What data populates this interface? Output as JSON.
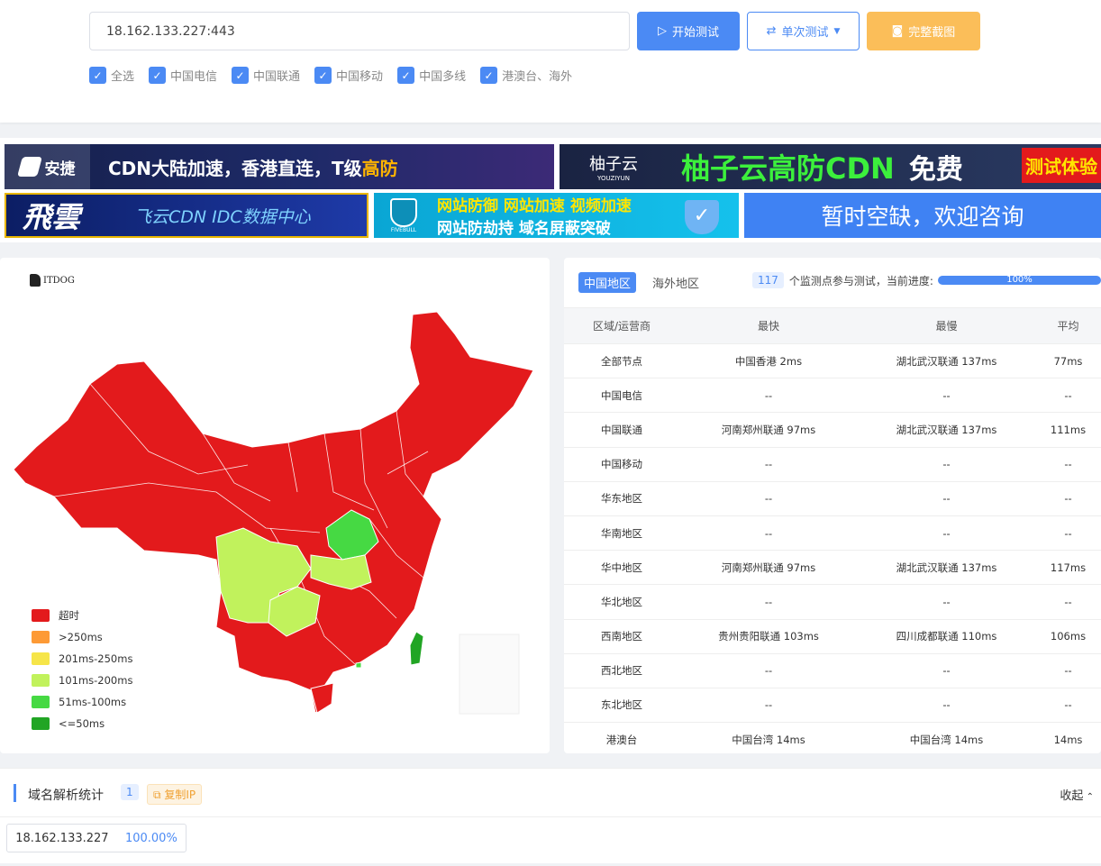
{
  "search": {
    "value": "18.162.133.227:443"
  },
  "buttons": {
    "start": "开始测试",
    "single": "单次测试",
    "screenshot": "完整截图"
  },
  "checkboxes": [
    "全选",
    "中国电信",
    "中国联通",
    "中国移动",
    "中国多线",
    "港澳台、海外"
  ],
  "banners": {
    "b1_brand": "安捷",
    "b1_text": "CDN大陆加速，香港直连，T级",
    "b1_highlight": "高防",
    "b2_brand": "柚子云",
    "b2_sub": "YOUZIYUN",
    "b2_text": "柚子云高防CDN",
    "b2_free": "免费",
    "b2_trial": "测试体验",
    "b3_brand": "飛雲",
    "b3_text": "飞云CDN IDC数据中心",
    "b4_line1": "网站防御 网站加速 视频加速",
    "b4_line2": "网站防劫持 域名屏蔽突破",
    "b4_sub": "FIVEBULL",
    "b5_text": "暂时空缺，欢迎咨询"
  },
  "map": {
    "logo": "ITDOG",
    "legend": [
      {
        "label": "超时",
        "color": "#e31a1c"
      },
      {
        "label": ">250ms",
        "color": "#fd9a35"
      },
      {
        "label": "201ms-250ms",
        "color": "#f6e549"
      },
      {
        "label": "101ms-200ms",
        "color": "#c1f25c"
      },
      {
        "label": "51ms-100ms",
        "color": "#46d943"
      },
      {
        "label": "<=50ms",
        "color": "#21a524"
      }
    ]
  },
  "results": {
    "tabs": [
      "中国地区",
      "海外地区"
    ],
    "node_count": "117",
    "count_text": "个监测点参与测试，当前进度:",
    "progress": "100%",
    "headers": [
      "区域/运营商",
      "最快",
      "最慢",
      "平均"
    ],
    "rows": [
      [
        "全部节点",
        "中国香港 2ms",
        "湖北武汉联通 137ms",
        "77ms"
      ],
      [
        "中国电信",
        "--",
        "--",
        "--"
      ],
      [
        "中国联通",
        "河南郑州联通 97ms",
        "湖北武汉联通 137ms",
        "111ms"
      ],
      [
        "中国移动",
        "--",
        "--",
        "--"
      ],
      [
        "华东地区",
        "--",
        "--",
        "--"
      ],
      [
        "华南地区",
        "--",
        "--",
        "--"
      ],
      [
        "华中地区",
        "河南郑州联通 97ms",
        "湖北武汉联通 137ms",
        "117ms"
      ],
      [
        "华北地区",
        "--",
        "--",
        "--"
      ],
      [
        "西南地区",
        "贵州贵阳联通 103ms",
        "四川成都联通 110ms",
        "106ms"
      ],
      [
        "西北地区",
        "--",
        "--",
        "--"
      ],
      [
        "东北地区",
        "--",
        "--",
        "--"
      ],
      [
        "港澳台",
        "中国台湾 14ms",
        "中国台湾 14ms",
        "14ms"
      ]
    ]
  },
  "dns": {
    "title": "域名解析统计",
    "count": "1",
    "copy": "复制IP",
    "collapse": "收起",
    "ip": "18.162.133.227",
    "percent": "100.00%"
  }
}
